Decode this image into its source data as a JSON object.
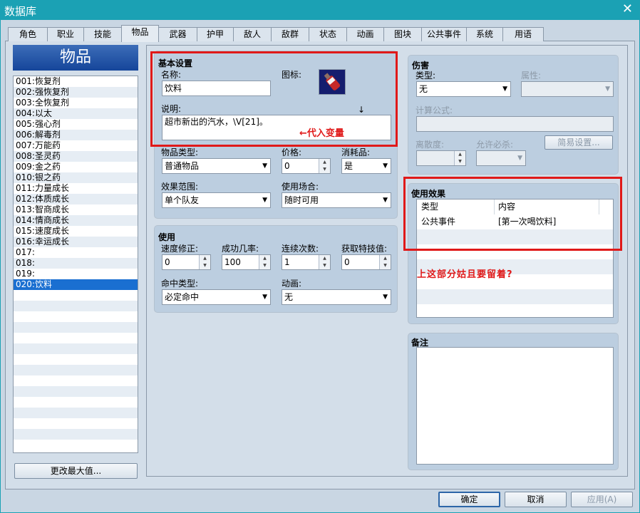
{
  "window": {
    "title": "数据库",
    "close_glyph": "✕"
  },
  "tabs": [
    "角色",
    "职业",
    "技能",
    "物品",
    "武器",
    "护甲",
    "敌人",
    "敌群",
    "状态",
    "动画",
    "图块",
    "公共事件",
    "系统",
    "用语"
  ],
  "active_tab": 3,
  "left": {
    "banner": "物品",
    "items": [
      "001:恢复剂",
      "002:强恢复剂",
      "003:全恢复剂",
      "004:以太",
      "005:强心剂",
      "006:解毒剂",
      "007:万能药",
      "008:圣灵药",
      "009:金之药",
      "010:银之药",
      "011:力量成长",
      "012:体质成长",
      "013:智商成长",
      "014:情商成长",
      "015:速度成长",
      "016:幸运成长",
      "017:",
      "018:",
      "019:",
      "020:饮料"
    ],
    "selected_index": 19,
    "change_max_button": "更改最大值..."
  },
  "basic": {
    "title": "基本设置",
    "name_label": "名称:",
    "name_value": "饮料",
    "icon_label": "图标:",
    "icon_name": "bottle-icon",
    "desc_label": "说明:",
    "desc_value": "超市新出的汽水，\\V[21]。",
    "arrow_mark": "↓",
    "annotation": "←代入变量",
    "type_label": "物品类型:",
    "type_value": "普通物品",
    "price_label": "价格:",
    "price_value": "0",
    "consumable_label": "消耗品:",
    "consumable_value": "是",
    "scope_label": "效果范围:",
    "scope_value": "单个队友",
    "occasion_label": "使用场合:",
    "occasion_value": "随时可用"
  },
  "usage": {
    "title": "使用",
    "speed_label": "速度修正:",
    "speed_value": "0",
    "success_label": "成功几率:",
    "success_value": "100",
    "repeat_label": "连续次数:",
    "repeat_value": "1",
    "tp_label": "获取特技值:",
    "tp_value": "0",
    "hit_label": "命中类型:",
    "hit_value": "必定命中",
    "anim_label": "动画:",
    "anim_value": "无"
  },
  "damage": {
    "title": "伤害",
    "type_label": "类型:",
    "type_value": "无",
    "element_label": "属性:",
    "formula_label": "计算公式:",
    "variance_label": "离散度:",
    "critical_label": "允许必杀:",
    "easy_button": "简易设置..."
  },
  "effects": {
    "title": "使用效果",
    "col_type": "类型",
    "col_content": "内容",
    "rows": [
      {
        "type": "公共事件",
        "content": "[第一次喝饮料]"
      }
    ],
    "annotation": "上这部分姑且要留着?"
  },
  "note": {
    "title": "备注"
  },
  "footer": {
    "ok": "确定",
    "cancel": "取消",
    "apply": "应用(A)"
  },
  "colors": {
    "accent": "#1ba1b4",
    "highlight": "#e01919",
    "selection": "#1a6fd1"
  }
}
